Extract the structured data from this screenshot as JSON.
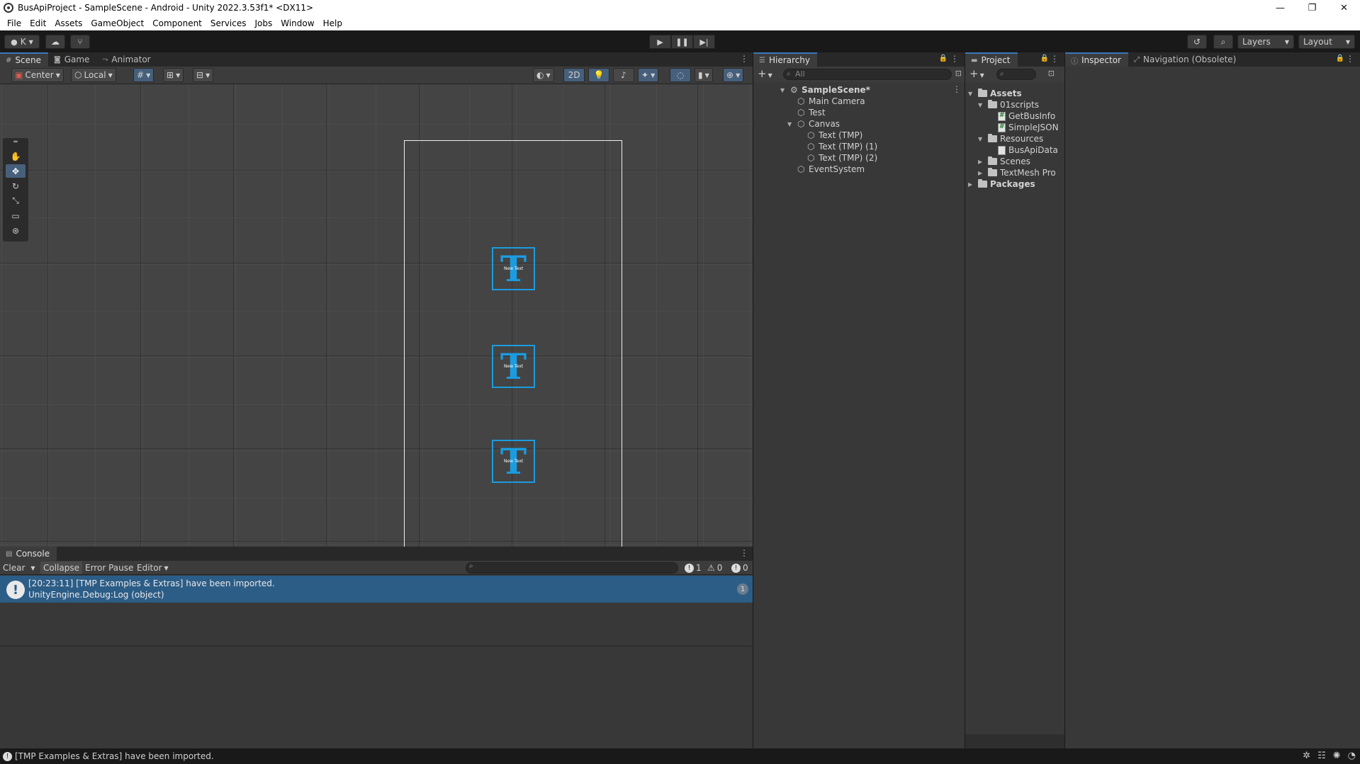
{
  "window": {
    "title": "BusApiProject - SampleScene - Android - Unity 2022.3.53f1* <DX11>",
    "controls": [
      "—",
      "❐",
      "✕"
    ]
  },
  "menubar": [
    "File",
    "Edit",
    "Assets",
    "GameObject",
    "Component",
    "Services",
    "Jobs",
    "Window",
    "Help"
  ],
  "toolbar": {
    "account_label": "K",
    "layers_label": "Layers",
    "layout_label": "Layout"
  },
  "scene_tabs": [
    "Scene",
    "Game",
    "Animator"
  ],
  "scene_toolbar": {
    "pivot_label": "Center",
    "space_label": "Local",
    "mode_2d_label": "2D"
  },
  "scene_objects": [
    {
      "label": "New Text"
    },
    {
      "label": "New Text"
    },
    {
      "label": "New Text"
    }
  ],
  "hierarchy": {
    "tab_label": "Hierarchy",
    "search_placeholder": "All",
    "scene_name": "SampleScene*",
    "items": [
      {
        "label": "Main Camera"
      },
      {
        "label": "Test"
      },
      {
        "label": "Canvas"
      },
      {
        "label": "Text (TMP)"
      },
      {
        "label": "Text (TMP) (1)"
      },
      {
        "label": "Text (TMP) (2)"
      },
      {
        "label": "EventSystem"
      }
    ]
  },
  "project": {
    "tab_label": "Project",
    "tree": [
      {
        "label": "Assets"
      },
      {
        "label": "01scripts"
      },
      {
        "label": "GetBusInfo"
      },
      {
        "label": "SimpleJSON"
      },
      {
        "label": "Resources"
      },
      {
        "label": "BusApiData"
      },
      {
        "label": "Scenes"
      },
      {
        "label": "TextMesh Pro"
      },
      {
        "label": "Packages"
      }
    ]
  },
  "inspector": {
    "tabs": [
      "Inspector",
      "Navigation (Obsolete)"
    ]
  },
  "console": {
    "tab_label": "Console",
    "buttons": [
      "Clear",
      "Collapse",
      "Error Pause",
      "Editor"
    ],
    "counts": {
      "info": "1",
      "warning": "0",
      "error": "0"
    },
    "log": {
      "line1": "[20:23:11] [TMP Examples & Extras] have been imported.",
      "line2": "UnityEngine.Debug:Log (object)",
      "count": "1"
    }
  },
  "statusbar": {
    "message": "[TMP Examples & Extras] have been imported."
  },
  "colors": {
    "accent": "#3a79bb",
    "selection": "#2c5d87",
    "tmp_blue": "#1b9ce0"
  }
}
